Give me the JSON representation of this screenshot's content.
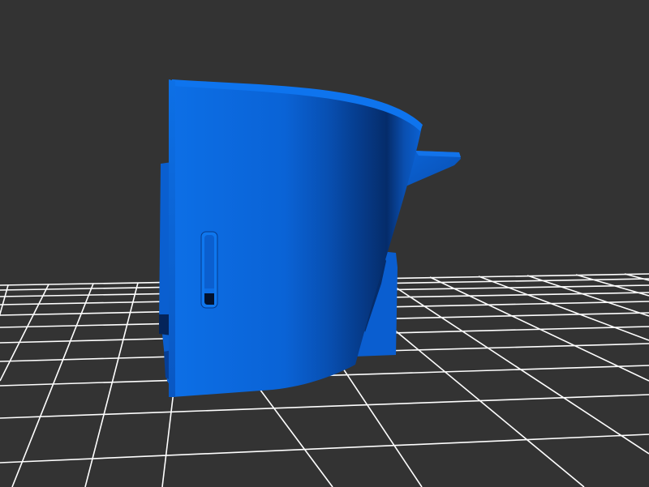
{
  "viewer": {
    "background_color": "#333333",
    "grid_color": "#ffffff",
    "model_color": "#0a6ae0",
    "model_shadow_color": "#021a4a"
  },
  "scene": {
    "grid_icon": "floor-grid",
    "model_icon": "3d-part-model"
  }
}
